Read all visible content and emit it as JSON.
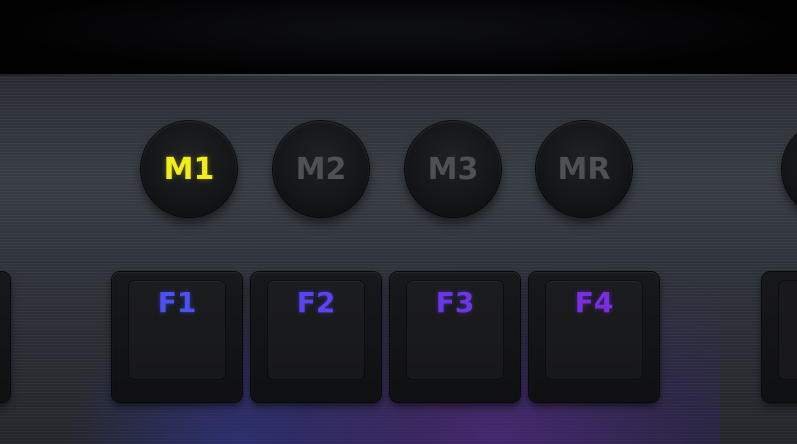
{
  "macro_keys": [
    {
      "label": "M1",
      "active": true,
      "color": "#f1ec1a"
    },
    {
      "label": "M2",
      "active": false,
      "color": "#4e5154"
    },
    {
      "label": "M3",
      "active": false,
      "color": "#4e5154"
    },
    {
      "label": "MR",
      "active": false,
      "color": "#4e5154"
    }
  ],
  "function_keys": [
    {
      "label": "F1",
      "color": "#4a52f2"
    },
    {
      "label": "F2",
      "color": "#5844f2"
    },
    {
      "label": "F3",
      "color": "#6a36e6"
    },
    {
      "label": "F4",
      "color": "#7a2ee0"
    }
  ],
  "colors": {
    "plate": "#3a3f47",
    "keycap": "#17181b",
    "backlight_glow": "#7828dc"
  }
}
